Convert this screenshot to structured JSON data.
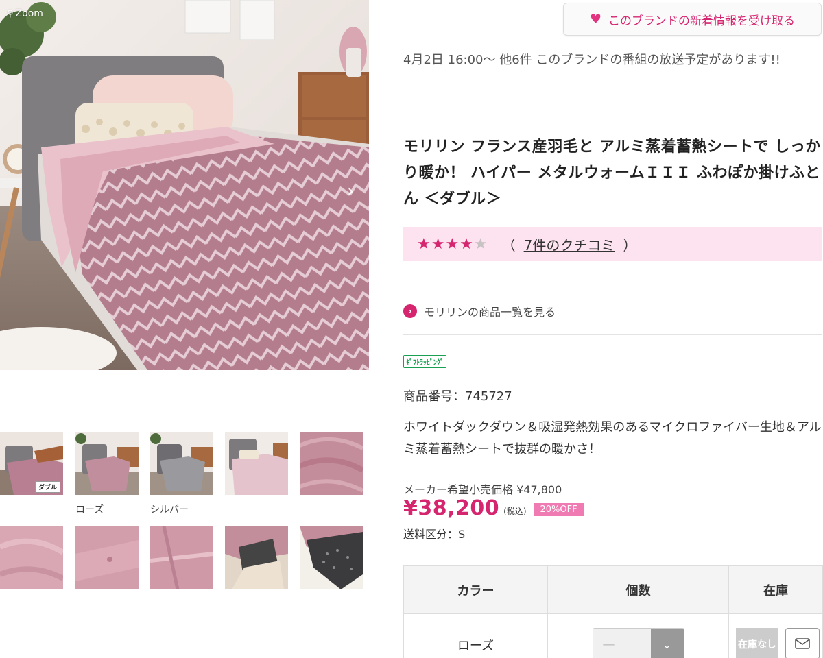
{
  "gallery": {
    "zoom_label": "Zoom",
    "next_arrow": "›",
    "thumbs": [
      {
        "tag": "ダブル",
        "caption": ""
      },
      {
        "caption": "ローズ"
      },
      {
        "caption": "シルバー"
      },
      {
        "caption": ""
      },
      {
        "caption": ""
      },
      {
        "caption": ""
      },
      {
        "caption": ""
      },
      {
        "caption": ""
      },
      {
        "caption": ""
      },
      {
        "caption": ""
      }
    ]
  },
  "follow_button": {
    "icon": "heart-icon",
    "label": "このブランドの新着情報を受け取る"
  },
  "broadcast": "4月2日 16:00～ 他6件 このブランドの番組の放送予定があります!!",
  "title": "モリリン フランス産羽毛と アルミ蒸着蓄熱シートで しっかり暖か！ ハイパー メタルウォームＩＩＩ ふわぽか掛けふとん ＜ダブル＞",
  "rating": {
    "stars": 4,
    "max": 5,
    "open_paren": "（",
    "close_paren": "）",
    "reviews_link": "7件のクチコミ"
  },
  "brand_link": {
    "arrow": "›",
    "label": "モリリンの商品一覧を見る"
  },
  "gift_badge": "ｷﾞﾌﾄﾗｯﾋﾟﾝｸﾞ",
  "product_no": "商品番号：745727",
  "description": "ホワイトダックダウン＆吸湿発熱効果のあるマイクロファイバー生地＆アルミ蒸着蓄熱シートで抜群の暖かさ！",
  "price": {
    "maker_label": "メーカー希望小売価格 ¥47,800",
    "value": "¥38,200",
    "tax": "(税込)",
    "discount": "20%OFF"
  },
  "shipping": {
    "link": "送料区分",
    "value": "：S"
  },
  "table": {
    "headers": [
      "カラー",
      "個数",
      "在庫"
    ],
    "rows": [
      {
        "color": "ローズ",
        "qty": "—",
        "stock": "在庫なし"
      }
    ]
  },
  "colors": {
    "accent": "#d6256f",
    "rating_bg": "#fde3ef",
    "off_badge": "#f07ab2",
    "gift_green": "#1aa052"
  }
}
